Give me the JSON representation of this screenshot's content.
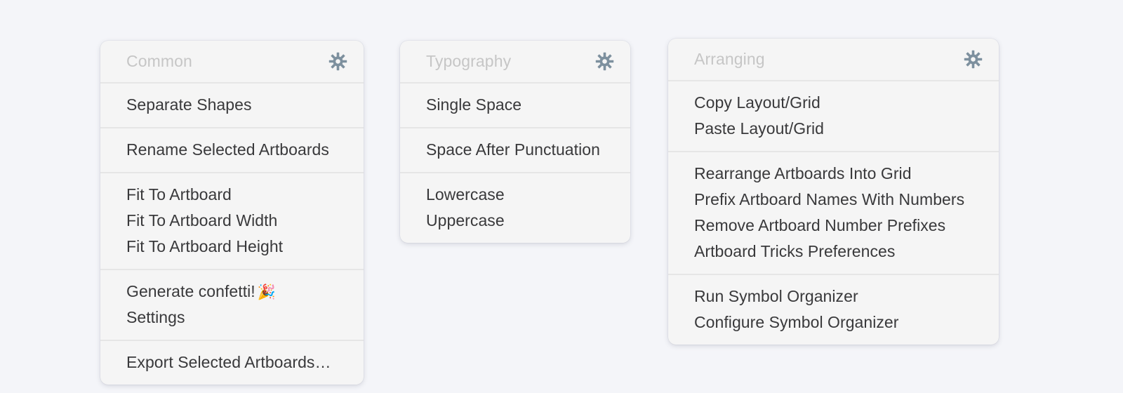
{
  "theme": {
    "background": "#f4f5f9",
    "panel_background": "#f5f5f5",
    "divider": "#e6e6e6",
    "title_color": "#c6c6c6",
    "item_color": "#39393b",
    "gear_color": "#7d909e"
  },
  "panels": [
    {
      "id": "common",
      "title": "Common",
      "gear_icon": "gear-icon",
      "groups": [
        {
          "items": [
            {
              "label": "Separate Shapes"
            }
          ]
        },
        {
          "items": [
            {
              "label": "Rename Selected Artboards"
            }
          ]
        },
        {
          "items": [
            {
              "label": "Fit To Artboard"
            },
            {
              "label": "Fit To Artboard Width"
            },
            {
              "label": "Fit To Artboard Height"
            }
          ]
        },
        {
          "items": [
            {
              "label": "Generate confetti!",
              "emoji": "🎉"
            },
            {
              "label": "Settings"
            }
          ]
        },
        {
          "items": [
            {
              "label": "Export Selected Artboards…"
            }
          ]
        }
      ]
    },
    {
      "id": "typography",
      "title": "Typography",
      "gear_icon": "gear-icon",
      "groups": [
        {
          "items": [
            {
              "label": "Single Space"
            }
          ]
        },
        {
          "items": [
            {
              "label": "Space After Punctuation"
            }
          ]
        },
        {
          "items": [
            {
              "label": "Lowercase"
            },
            {
              "label": "Uppercase"
            }
          ]
        }
      ]
    },
    {
      "id": "arranging",
      "title": "Arranging",
      "gear_icon": "gear-icon",
      "groups": [
        {
          "items": [
            {
              "label": "Copy Layout/Grid"
            },
            {
              "label": "Paste Layout/Grid"
            }
          ]
        },
        {
          "items": [
            {
              "label": "Rearrange Artboards Into Grid"
            },
            {
              "label": "Prefix Artboard Names With Numbers"
            },
            {
              "label": "Remove Artboard Number Prefixes"
            },
            {
              "label": "Artboard Tricks Preferences"
            }
          ]
        },
        {
          "items": [
            {
              "label": "Run Symbol Organizer"
            },
            {
              "label": "Configure Symbol Organizer"
            }
          ]
        }
      ]
    }
  ]
}
